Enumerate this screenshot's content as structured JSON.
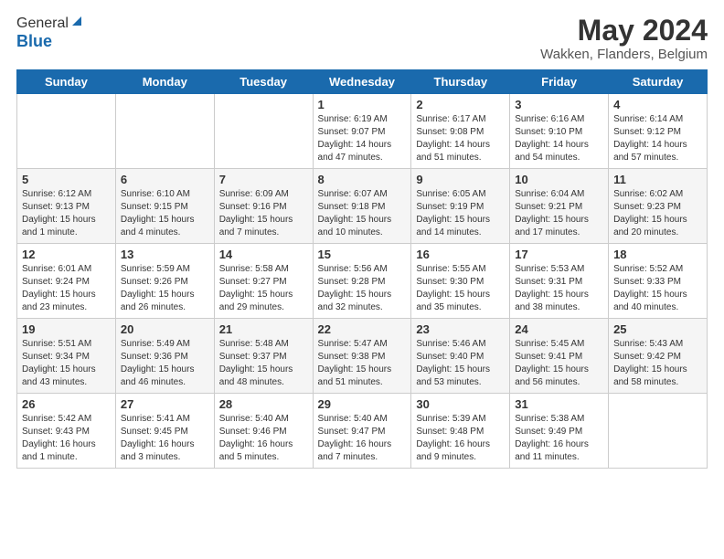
{
  "header": {
    "logo_general": "General",
    "logo_blue": "Blue",
    "month_title": "May 2024",
    "location": "Wakken, Flanders, Belgium"
  },
  "days_of_week": [
    "Sunday",
    "Monday",
    "Tuesday",
    "Wednesday",
    "Thursday",
    "Friday",
    "Saturday"
  ],
  "weeks": [
    [
      {
        "day": "",
        "sunrise": "",
        "sunset": "",
        "daylight": ""
      },
      {
        "day": "",
        "sunrise": "",
        "sunset": "",
        "daylight": ""
      },
      {
        "day": "",
        "sunrise": "",
        "sunset": "",
        "daylight": ""
      },
      {
        "day": "1",
        "sunrise": "Sunrise: 6:19 AM",
        "sunset": "Sunset: 9:07 PM",
        "daylight": "Daylight: 14 hours and 47 minutes."
      },
      {
        "day": "2",
        "sunrise": "Sunrise: 6:17 AM",
        "sunset": "Sunset: 9:08 PM",
        "daylight": "Daylight: 14 hours and 51 minutes."
      },
      {
        "day": "3",
        "sunrise": "Sunrise: 6:16 AM",
        "sunset": "Sunset: 9:10 PM",
        "daylight": "Daylight: 14 hours and 54 minutes."
      },
      {
        "day": "4",
        "sunrise": "Sunrise: 6:14 AM",
        "sunset": "Sunset: 9:12 PM",
        "daylight": "Daylight: 14 hours and 57 minutes."
      }
    ],
    [
      {
        "day": "5",
        "sunrise": "Sunrise: 6:12 AM",
        "sunset": "Sunset: 9:13 PM",
        "daylight": "Daylight: 15 hours and 1 minute."
      },
      {
        "day": "6",
        "sunrise": "Sunrise: 6:10 AM",
        "sunset": "Sunset: 9:15 PM",
        "daylight": "Daylight: 15 hours and 4 minutes."
      },
      {
        "day": "7",
        "sunrise": "Sunrise: 6:09 AM",
        "sunset": "Sunset: 9:16 PM",
        "daylight": "Daylight: 15 hours and 7 minutes."
      },
      {
        "day": "8",
        "sunrise": "Sunrise: 6:07 AM",
        "sunset": "Sunset: 9:18 PM",
        "daylight": "Daylight: 15 hours and 10 minutes."
      },
      {
        "day": "9",
        "sunrise": "Sunrise: 6:05 AM",
        "sunset": "Sunset: 9:19 PM",
        "daylight": "Daylight: 15 hours and 14 minutes."
      },
      {
        "day": "10",
        "sunrise": "Sunrise: 6:04 AM",
        "sunset": "Sunset: 9:21 PM",
        "daylight": "Daylight: 15 hours and 17 minutes."
      },
      {
        "day": "11",
        "sunrise": "Sunrise: 6:02 AM",
        "sunset": "Sunset: 9:23 PM",
        "daylight": "Daylight: 15 hours and 20 minutes."
      }
    ],
    [
      {
        "day": "12",
        "sunrise": "Sunrise: 6:01 AM",
        "sunset": "Sunset: 9:24 PM",
        "daylight": "Daylight: 15 hours and 23 minutes."
      },
      {
        "day": "13",
        "sunrise": "Sunrise: 5:59 AM",
        "sunset": "Sunset: 9:26 PM",
        "daylight": "Daylight: 15 hours and 26 minutes."
      },
      {
        "day": "14",
        "sunrise": "Sunrise: 5:58 AM",
        "sunset": "Sunset: 9:27 PM",
        "daylight": "Daylight: 15 hours and 29 minutes."
      },
      {
        "day": "15",
        "sunrise": "Sunrise: 5:56 AM",
        "sunset": "Sunset: 9:28 PM",
        "daylight": "Daylight: 15 hours and 32 minutes."
      },
      {
        "day": "16",
        "sunrise": "Sunrise: 5:55 AM",
        "sunset": "Sunset: 9:30 PM",
        "daylight": "Daylight: 15 hours and 35 minutes."
      },
      {
        "day": "17",
        "sunrise": "Sunrise: 5:53 AM",
        "sunset": "Sunset: 9:31 PM",
        "daylight": "Daylight: 15 hours and 38 minutes."
      },
      {
        "day": "18",
        "sunrise": "Sunrise: 5:52 AM",
        "sunset": "Sunset: 9:33 PM",
        "daylight": "Daylight: 15 hours and 40 minutes."
      }
    ],
    [
      {
        "day": "19",
        "sunrise": "Sunrise: 5:51 AM",
        "sunset": "Sunset: 9:34 PM",
        "daylight": "Daylight: 15 hours and 43 minutes."
      },
      {
        "day": "20",
        "sunrise": "Sunrise: 5:49 AM",
        "sunset": "Sunset: 9:36 PM",
        "daylight": "Daylight: 15 hours and 46 minutes."
      },
      {
        "day": "21",
        "sunrise": "Sunrise: 5:48 AM",
        "sunset": "Sunset: 9:37 PM",
        "daylight": "Daylight: 15 hours and 48 minutes."
      },
      {
        "day": "22",
        "sunrise": "Sunrise: 5:47 AM",
        "sunset": "Sunset: 9:38 PM",
        "daylight": "Daylight: 15 hours and 51 minutes."
      },
      {
        "day": "23",
        "sunrise": "Sunrise: 5:46 AM",
        "sunset": "Sunset: 9:40 PM",
        "daylight": "Daylight: 15 hours and 53 minutes."
      },
      {
        "day": "24",
        "sunrise": "Sunrise: 5:45 AM",
        "sunset": "Sunset: 9:41 PM",
        "daylight": "Daylight: 15 hours and 56 minutes."
      },
      {
        "day": "25",
        "sunrise": "Sunrise: 5:43 AM",
        "sunset": "Sunset: 9:42 PM",
        "daylight": "Daylight: 15 hours and 58 minutes."
      }
    ],
    [
      {
        "day": "26",
        "sunrise": "Sunrise: 5:42 AM",
        "sunset": "Sunset: 9:43 PM",
        "daylight": "Daylight: 16 hours and 1 minute."
      },
      {
        "day": "27",
        "sunrise": "Sunrise: 5:41 AM",
        "sunset": "Sunset: 9:45 PM",
        "daylight": "Daylight: 16 hours and 3 minutes."
      },
      {
        "day": "28",
        "sunrise": "Sunrise: 5:40 AM",
        "sunset": "Sunset: 9:46 PM",
        "daylight": "Daylight: 16 hours and 5 minutes."
      },
      {
        "day": "29",
        "sunrise": "Sunrise: 5:40 AM",
        "sunset": "Sunset: 9:47 PM",
        "daylight": "Daylight: 16 hours and 7 minutes."
      },
      {
        "day": "30",
        "sunrise": "Sunrise: 5:39 AM",
        "sunset": "Sunset: 9:48 PM",
        "daylight": "Daylight: 16 hours and 9 minutes."
      },
      {
        "day": "31",
        "sunrise": "Sunrise: 5:38 AM",
        "sunset": "Sunset: 9:49 PM",
        "daylight": "Daylight: 16 hours and 11 minutes."
      },
      {
        "day": "",
        "sunrise": "",
        "sunset": "",
        "daylight": ""
      }
    ]
  ]
}
